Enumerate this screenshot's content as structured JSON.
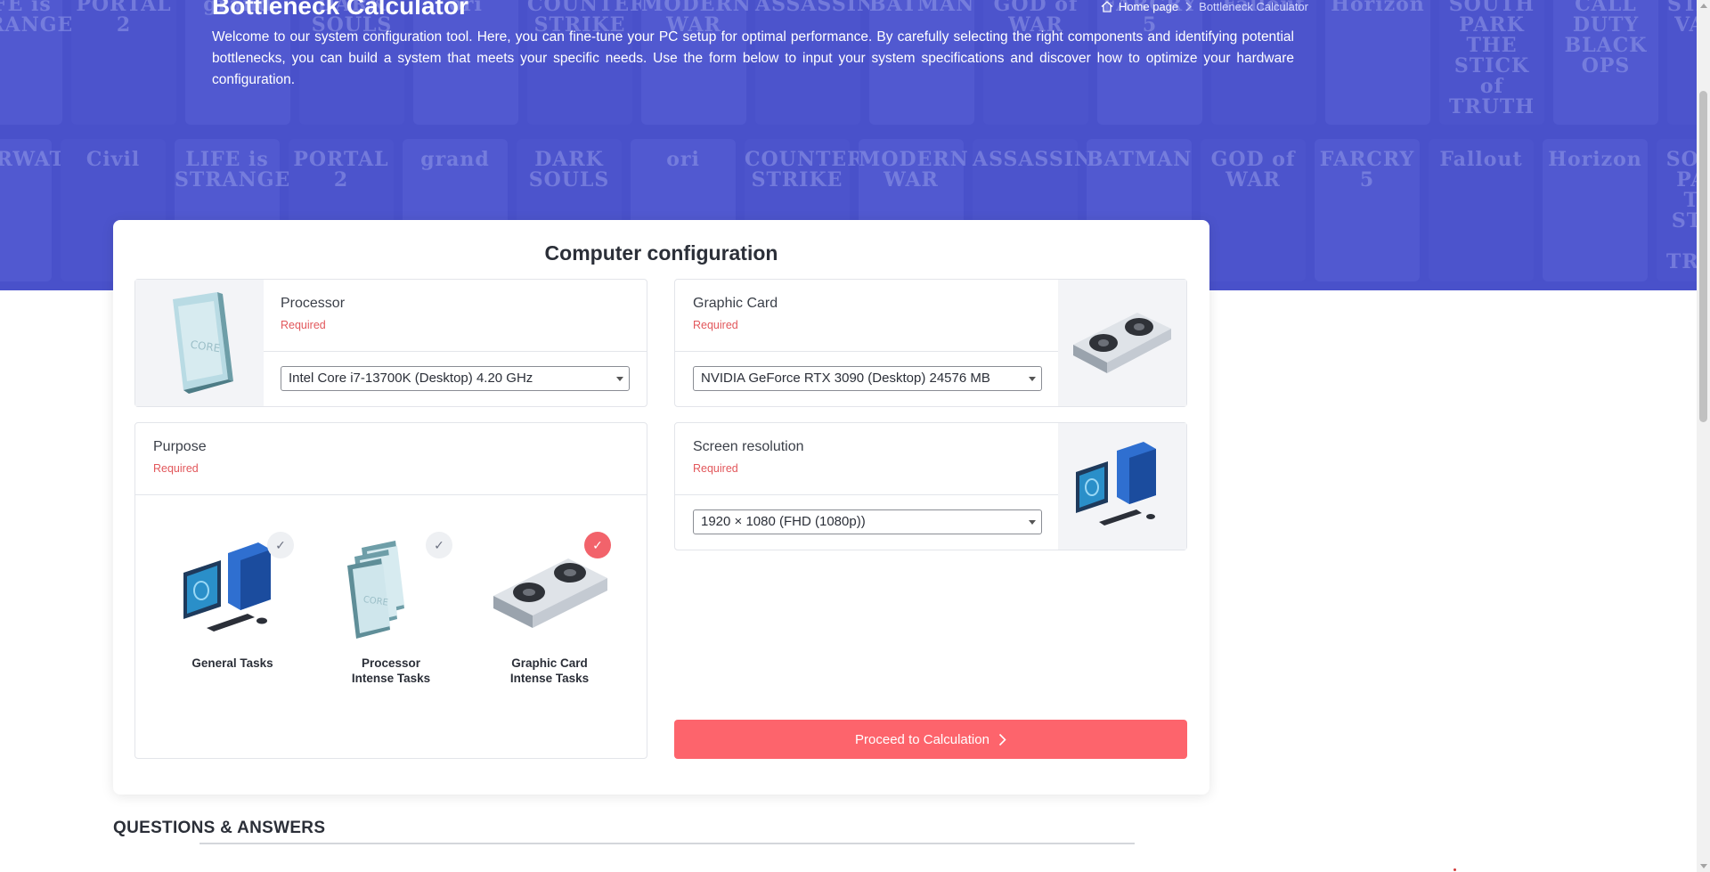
{
  "hero": {
    "title": "Bottleneck Calculator",
    "description": "Welcome to our system configuration tool. Here, you can fine-tune your PC setup for optimal performance. By carefully selecting the right components and identifying potential bottlenecks, you can build a system that meets your specific needs. Use the form below to input your system specifications and discover how to optimize your hardware configuration.",
    "breadcrumb": {
      "home": "Home page",
      "current": "Bottleneck Calculator"
    },
    "game_tiles": [
      "LIFE is STRANGE",
      "PORTAL 2",
      "grand",
      "DARK SOULS",
      "ori",
      "COUNTER STRIKE",
      "MODERN WAR",
      "ASSASSIN'S",
      "BATMAN",
      "GOD of WAR",
      "FARCRY 5",
      "Fallout",
      "Horizon",
      "SOUTH PARK THE STICK of TRUTH",
      "CALL DUTY BLACK OPS",
      "STARDEW VALLEY",
      "OVERWATCH",
      "Civil"
    ]
  },
  "card": {
    "title": "Computer configuration",
    "processor": {
      "label": "Processor",
      "required": "Required",
      "selected": "Intel Core i7-13700K (Desktop) 4.20 GHz"
    },
    "graphic_card": {
      "label": "Graphic Card",
      "required": "Required",
      "selected": "NVIDIA GeForce RTX 3090 (Desktop) 24576 MB"
    },
    "purpose": {
      "label": "Purpose",
      "required": "Required",
      "options": [
        {
          "line1": "General Tasks",
          "line2": "",
          "selected": false
        },
        {
          "line1": "Processor",
          "line2": "Intense Tasks",
          "selected": false
        },
        {
          "line1": "Graphic Card",
          "line2": "Intense Tasks",
          "selected": true
        }
      ]
    },
    "screen_resolution": {
      "label": "Screen resolution",
      "required": "Required",
      "selected": "1920 × 1080 (FHD (1080p))"
    },
    "proceed_label": "Proceed to Calculation"
  },
  "qa_heading": "QUESTIONS & ANSWERS",
  "colors": {
    "hero": "#4b53c9",
    "accent": "#fd646c",
    "required": "#e2575b"
  },
  "icons": [
    "home-icon",
    "chevron-right-icon",
    "check-icon",
    "dropdown-caret-icon"
  ]
}
